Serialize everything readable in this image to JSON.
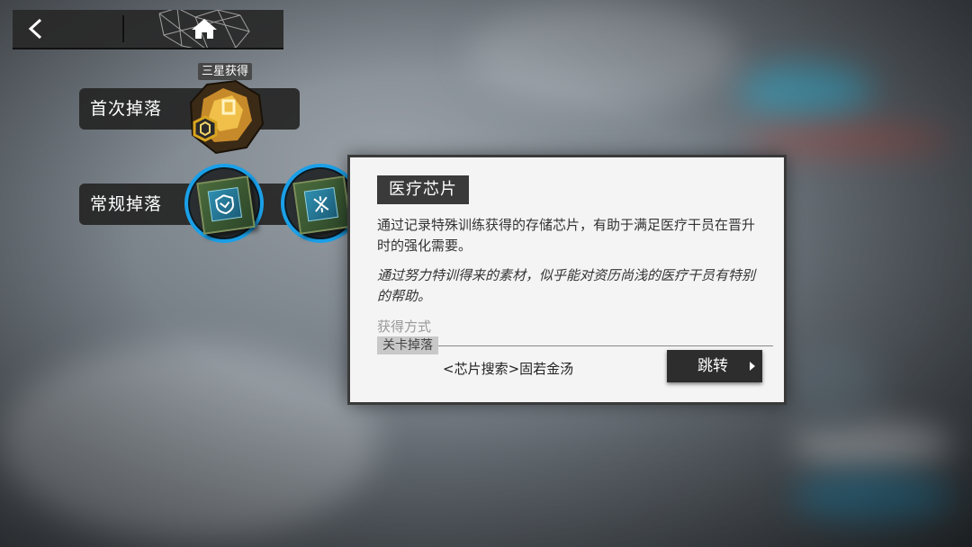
{
  "topbar": {
    "back_icon": "chevron-left-icon",
    "home_icon": "home-icon"
  },
  "drops": {
    "first_drop_label": "首次掉落",
    "regular_drop_label": "常规掉落",
    "star_badge": "三星获得"
  },
  "tooltip": {
    "title": "医疗芯片",
    "description": "通过记录特殊训练获得的存储芯片，有助于满足医疗干员在晋升时的强化需要。",
    "flavor": "通过努力特训得来的素材，似乎能对资历尚浅的医疗干员有特别的帮助。",
    "acquire_label": "获得方式",
    "acquire_tag": "关卡掉落",
    "stage_name": "<芯片搜索>固若金汤",
    "jump_button": "跳转"
  },
  "colors": {
    "accent_blue": "#1aa0e8",
    "panel_bg": "#f4f4f4",
    "dark_bar": "#2d2d2d",
    "gold": "#d9a521"
  }
}
